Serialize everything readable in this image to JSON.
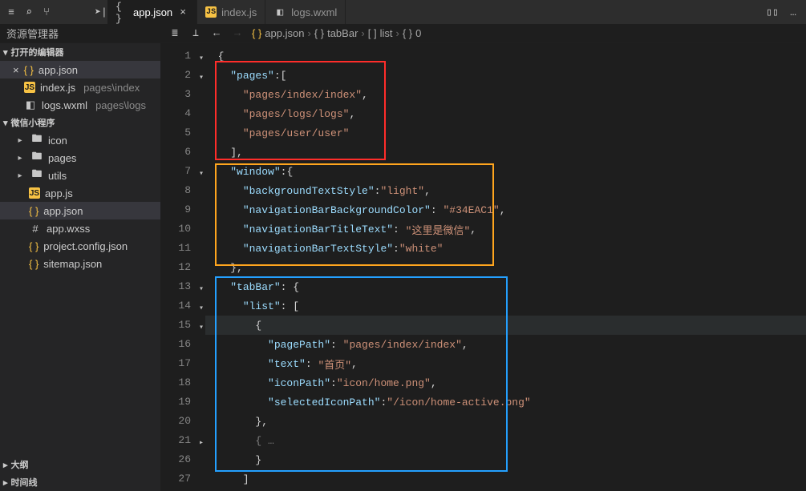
{
  "icons": {
    "menu": "≡",
    "search": "⌕",
    "branch": "⑂",
    "compass": "➤|",
    "split": "▯▯",
    "more": "…",
    "list": "≣",
    "bookmark": "⟂",
    "back": "←",
    "json": "{ }",
    "js": "JS",
    "wxml": "◧",
    "wxss": "#",
    "folder": "▸",
    "chev_down": "▾",
    "chev_right": "▸",
    "close": "×",
    "brackets": "[ ]",
    "braces": "{ }"
  },
  "sidebar": {
    "explorer_title": "资源管理器",
    "section_open_editors": "打开的编辑器",
    "section_project": "微信小程序",
    "section_outline": "大纲",
    "section_timeline": "时间线",
    "open_editors": [
      {
        "name": "app.json",
        "icon": "json",
        "active": true,
        "close": true
      },
      {
        "name": "index.js",
        "icon": "js",
        "right": "pages\\index"
      },
      {
        "name": "logs.wxml",
        "icon": "wxml",
        "right": "pages\\logs"
      }
    ],
    "tree": [
      {
        "name": "icon",
        "icon": "folder-teal",
        "twist": "▸",
        "indent": 18
      },
      {
        "name": "pages",
        "icon": "folder-red",
        "twist": "▸",
        "indent": 18
      },
      {
        "name": "utils",
        "icon": "folder-green",
        "twist": "▸",
        "indent": 18
      },
      {
        "name": "app.js",
        "icon": "js",
        "twist": "",
        "indent": 32
      },
      {
        "name": "app.json",
        "icon": "json",
        "twist": "",
        "indent": 32,
        "active": true
      },
      {
        "name": "app.wxss",
        "icon": "wxss",
        "twist": "",
        "indent": 32
      },
      {
        "name": "project.config.json",
        "icon": "json",
        "twist": "",
        "indent": 32
      },
      {
        "name": "sitemap.json",
        "icon": "json",
        "twist": "",
        "indent": 32
      }
    ]
  },
  "tabs": [
    {
      "name": "app.json",
      "icon": "json",
      "active": true
    },
    {
      "name": "index.js",
      "icon": "js"
    },
    {
      "name": "logs.wxml",
      "icon": "wxml"
    }
  ],
  "breadcrumbs": [
    {
      "icon": "json",
      "label": "app.json"
    },
    {
      "icon": "braces",
      "label": "tabBar"
    },
    {
      "icon": "brackets",
      "label": "list"
    },
    {
      "icon": "braces",
      "label": "0"
    }
  ],
  "code": {
    "pages_key": "\"pages\"",
    "pages_v0": "\"pages/index/index\"",
    "pages_v1": "\"pages/logs/logs\"",
    "pages_v2": "\"pages/user/user\"",
    "window_key": "\"window\"",
    "win_k0": "\"backgroundTextStyle\"",
    "win_v0": "\"light\"",
    "win_k1": "\"navigationBarBackgroundColor\"",
    "win_v1": "\"#34EAC1\"",
    "win_k2": "\"navigationBarTitleText\"",
    "win_v2": "\"这里是微信\"",
    "win_k3": "\"navigationBarTextStyle\"",
    "win_v3": "\"white\"",
    "tabbar_key": "\"tabBar\"",
    "list_key": "\"list\"",
    "item_k0": "\"pagePath\"",
    "item_v0": "\"pages/index/index\"",
    "item_k1": "\"text\"",
    "item_v1": "\"首页\"",
    "item_k2": "\"iconPath\"",
    "item_v2": "\"icon/home.png\"",
    "item_k3": "\"selectedIconPath\"",
    "item_v3": "\"/icon/home-active.png\"",
    "folded": "{ …"
  },
  "line_numbers": [
    "1",
    "2",
    "3",
    "4",
    "5",
    "6",
    "7",
    "8",
    "9",
    "10",
    "11",
    "12",
    "13",
    "14",
    "15",
    "16",
    "17",
    "18",
    "19",
    "20",
    "21",
    "26",
    "27"
  ]
}
